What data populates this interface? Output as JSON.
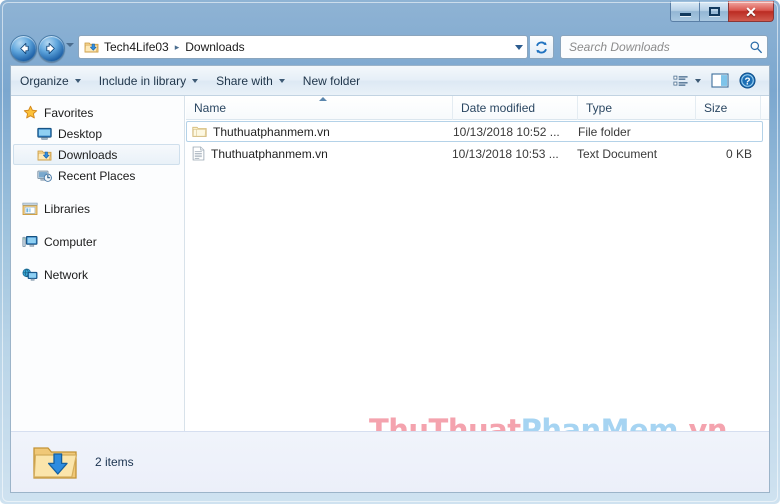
{
  "window": {
    "controls": {
      "minimize_label": "Minimize",
      "maximize_label": "Maximize",
      "close_label": "✕"
    }
  },
  "nav": {
    "back_label": "Back",
    "forward_label": "Forward",
    "history_label": "Recent pages",
    "refresh_label": "Refresh",
    "address": {
      "icon": "downloads-folder-icon",
      "crumbs": [
        "Tech4Life03",
        "Downloads"
      ],
      "separator": "▸"
    },
    "search": {
      "placeholder": "Search Downloads",
      "icon": "search-icon"
    }
  },
  "toolbar": {
    "items": [
      {
        "label": "Organize",
        "caret": true
      },
      {
        "label": "Include in library",
        "caret": true
      },
      {
        "label": "Share with",
        "caret": true
      },
      {
        "label": "New folder",
        "caret": false
      }
    ],
    "view_icon": "view-options-icon",
    "view_caret": true,
    "preview_icon": "preview-pane-icon",
    "help_icon": "help-icon"
  },
  "sidebar": {
    "items": [
      {
        "label": "Favorites",
        "icon": "star-icon",
        "indent": false,
        "selected": false,
        "gap_after": false
      },
      {
        "label": "Desktop",
        "icon": "desktop-icon",
        "indent": true,
        "selected": false,
        "gap_after": false
      },
      {
        "label": "Downloads",
        "icon": "downloads-folder-icon",
        "indent": true,
        "selected": true,
        "gap_after": false
      },
      {
        "label": "Recent Places",
        "icon": "recent-places-icon",
        "indent": true,
        "selected": false,
        "gap_after": true
      },
      {
        "label": "Libraries",
        "icon": "libraries-icon",
        "indent": false,
        "selected": false,
        "gap_after": true
      },
      {
        "label": "Computer",
        "icon": "computer-icon",
        "indent": false,
        "selected": false,
        "gap_after": true
      },
      {
        "label": "Network",
        "icon": "network-icon",
        "indent": false,
        "selected": false,
        "gap_after": false
      }
    ]
  },
  "filelist": {
    "columns": [
      {
        "key": "name",
        "label": "Name",
        "sorted": true,
        "sort_dir": "asc"
      },
      {
        "key": "date",
        "label": "Date modified",
        "sorted": false,
        "sort_dir": ""
      },
      {
        "key": "type",
        "label": "Type",
        "sorted": false,
        "sort_dir": ""
      },
      {
        "key": "size",
        "label": "Size",
        "sorted": false,
        "sort_dir": ""
      }
    ],
    "rows": [
      {
        "name": "Thuthuatphanmem.vn",
        "date": "10/13/2018 10:52 ...",
        "type": "File folder",
        "size": "",
        "icon": "folder-icon",
        "focused": true
      },
      {
        "name": "Thuthuatphanmem.vn",
        "date": "10/13/2018 10:53 ...",
        "type": "Text Document",
        "size": "0 KB",
        "icon": "text-document-icon",
        "focused": false
      }
    ]
  },
  "watermark": {
    "part1": "ThuThuat",
    "part2": "PhanMem",
    "part3": ".vn",
    "color_pink": "#f4a3ae",
    "color_blue": "#a6d4f2"
  },
  "status": {
    "icon": "downloads-folder-large-icon",
    "text": "2 items"
  }
}
